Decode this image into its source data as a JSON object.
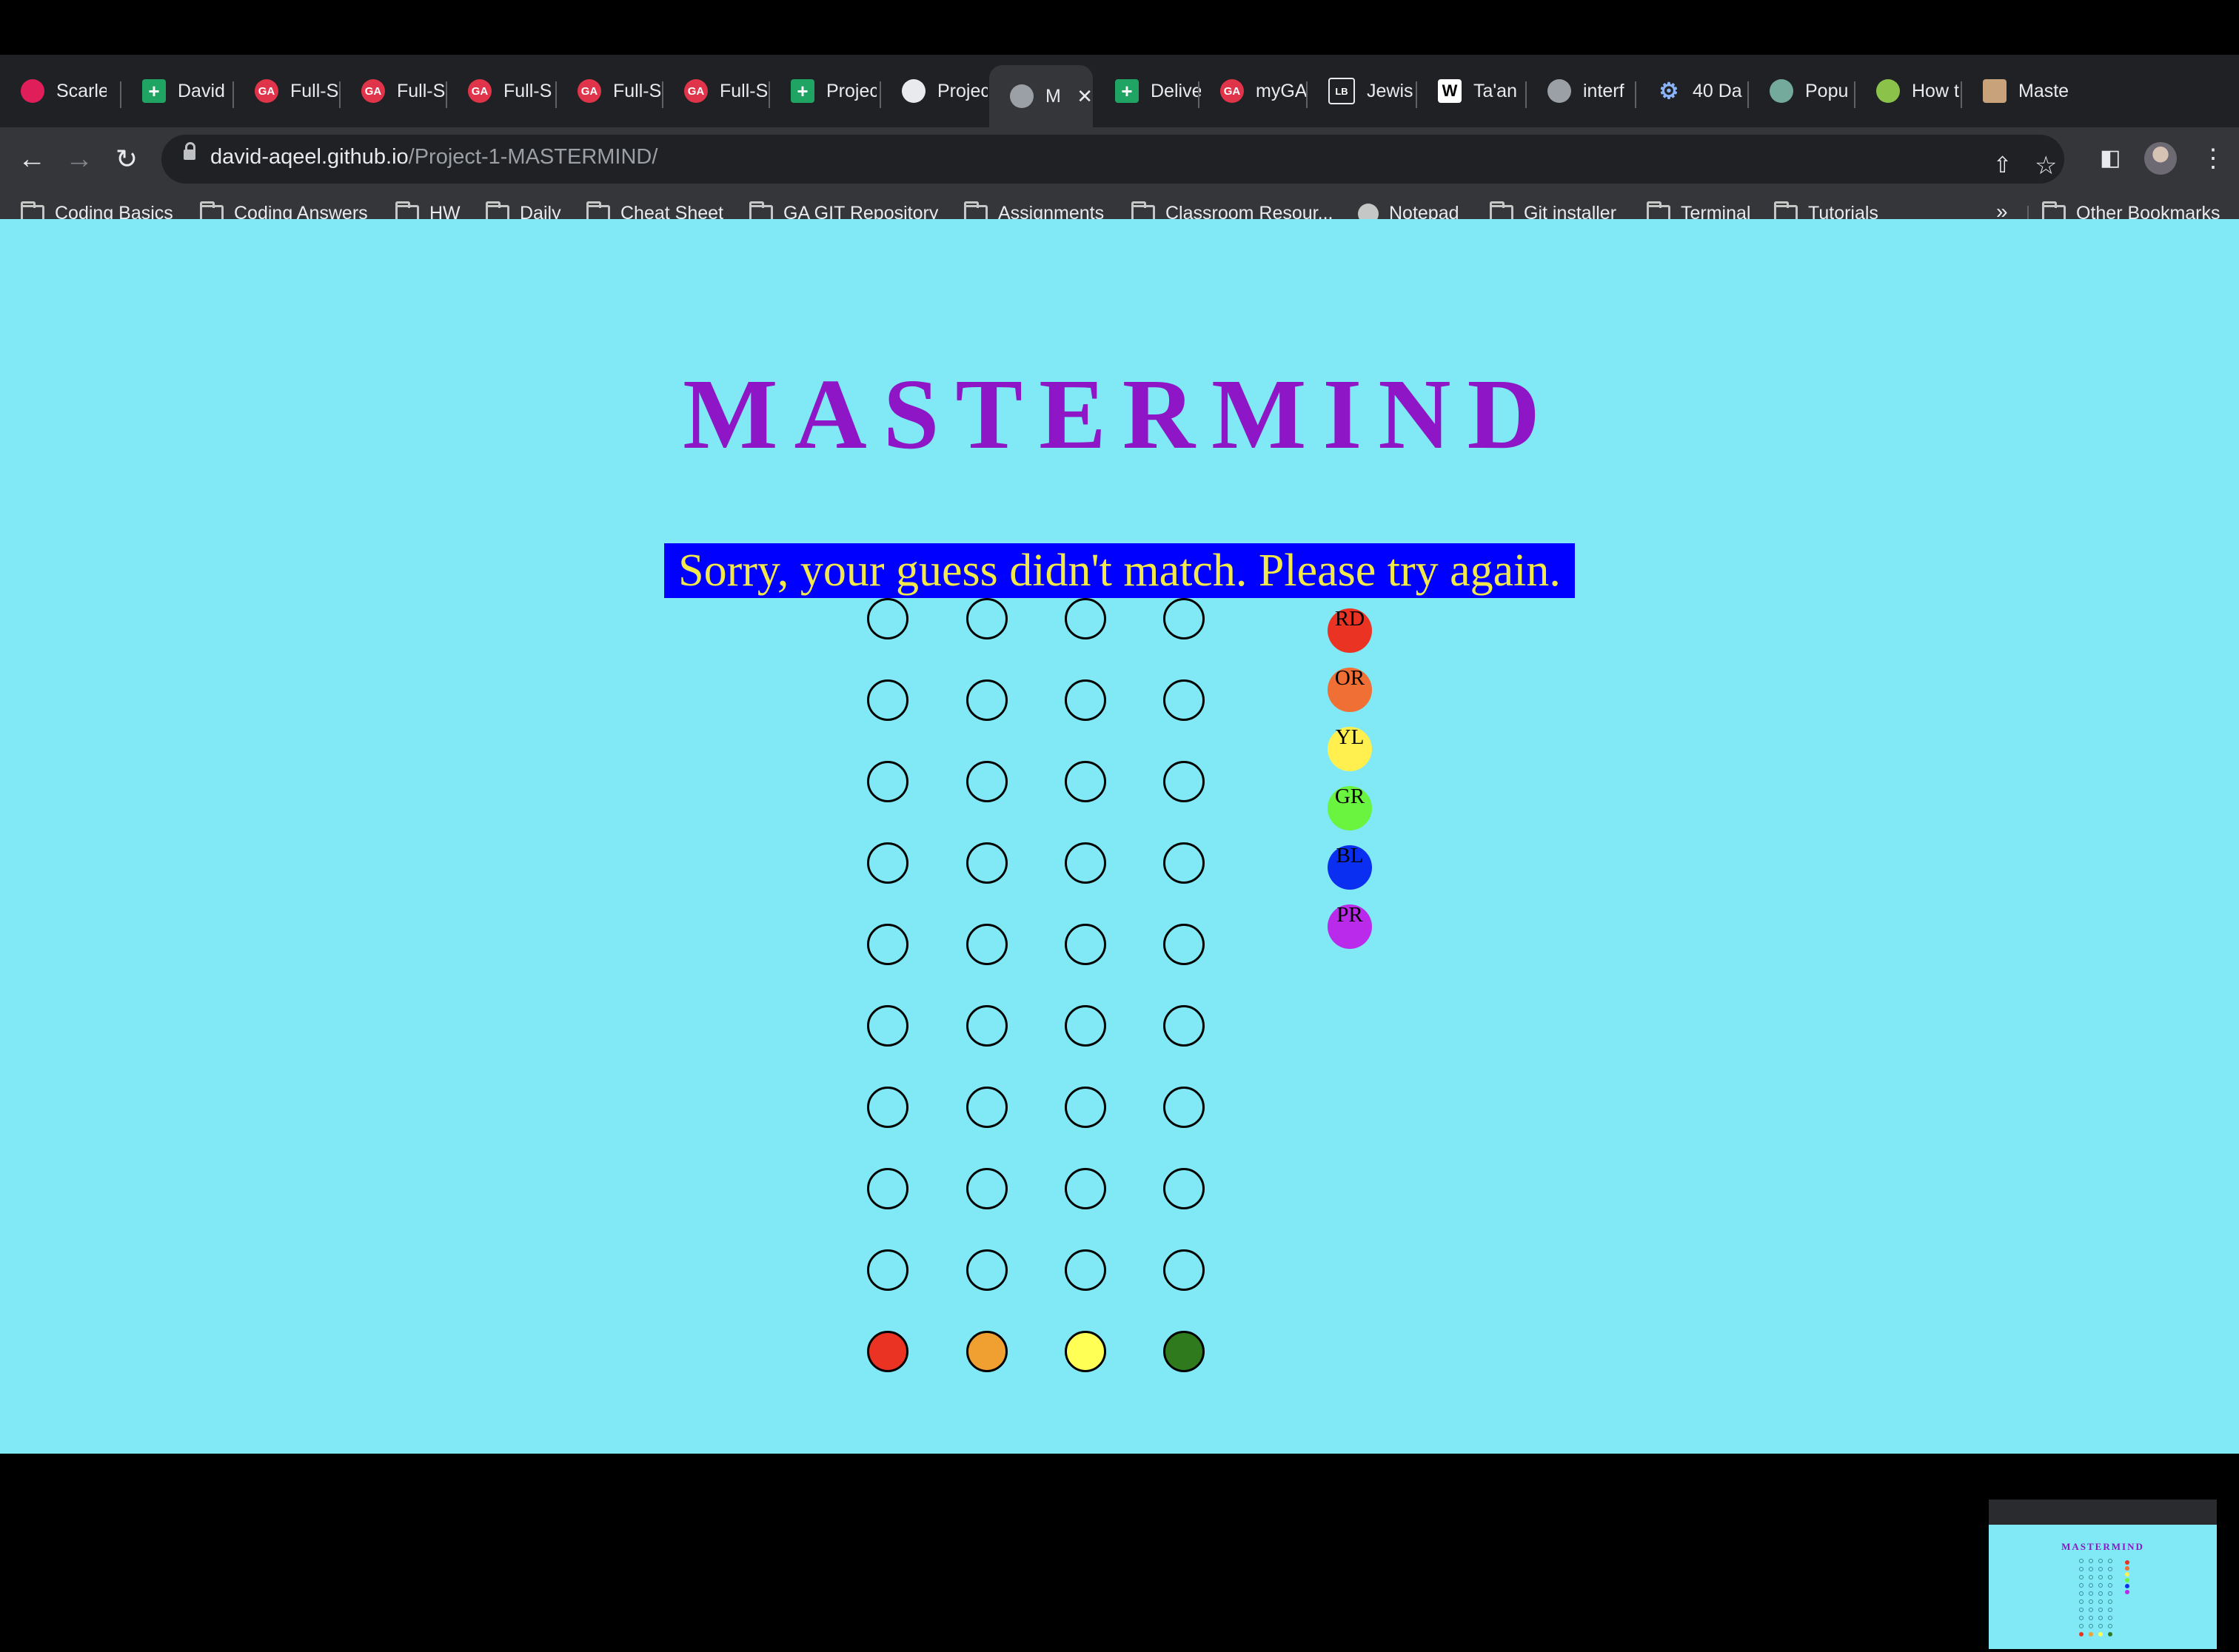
{
  "browser": {
    "tabs": [
      {
        "title": "Scarle",
        "icon": "slack-icon",
        "icon_color": "#e01e5a"
      },
      {
        "title": "David",
        "icon": "sheets-icon",
        "icon_color": "#1fa463"
      },
      {
        "title": "Full-S",
        "icon": "ga-icon",
        "icon_color": "#e0344b"
      },
      {
        "title": "Full-S",
        "icon": "ga-icon",
        "icon_color": "#e0344b"
      },
      {
        "title": "Full-S",
        "icon": "ga-icon",
        "icon_color": "#e0344b"
      },
      {
        "title": "Full-S",
        "icon": "ga-icon",
        "icon_color": "#e0344b"
      },
      {
        "title": "Full-S",
        "icon": "ga-icon",
        "icon_color": "#e0344b"
      },
      {
        "title": "Projec",
        "icon": "sheets-icon",
        "icon_color": "#1fa463"
      },
      {
        "title": "Projec",
        "icon": "github-icon",
        "icon_color": "#ffffff"
      },
      {
        "title": "Ma",
        "icon": "globe-icon",
        "icon_color": "#9aa0a6",
        "active": true
      },
      {
        "title": "Delive",
        "icon": "sheets-icon",
        "icon_color": "#1fa463"
      },
      {
        "title": "myGA",
        "icon": "ga-icon",
        "icon_color": "#e0344b"
      },
      {
        "title": "Jewis",
        "icon": "lb-icon",
        "icon_color": "#202124"
      },
      {
        "title": "Ta'an",
        "icon": "wikipedia-icon",
        "icon_color": "#ffffff"
      },
      {
        "title": "interf",
        "icon": "globe-icon",
        "icon_color": "#9aa0a6"
      },
      {
        "title": "40 Da",
        "icon": "gear-icon",
        "icon_color": "#8ab4f8"
      },
      {
        "title": "Popu",
        "icon": "openai-icon",
        "icon_color": "#74aa9c"
      },
      {
        "title": "How t",
        "icon": "ai-icon",
        "icon_color": "#8bc34a"
      },
      {
        "title": "Maste",
        "icon": "avatar-icon",
        "icon_color": "#c8a27a"
      }
    ],
    "url": {
      "host": "david-aqeel.github.io",
      "path": "/Project-1-MASTERMIND/"
    },
    "bookmarks": [
      {
        "label": "Coding Basics",
        "icon": "folder-icon"
      },
      {
        "label": "Coding Answers",
        "icon": "folder-icon"
      },
      {
        "label": "HW",
        "icon": "folder-icon"
      },
      {
        "label": "Daily",
        "icon": "folder-icon"
      },
      {
        "label": "Cheat Sheet",
        "icon": "folder-icon"
      },
      {
        "label": "GA GIT Repository",
        "icon": "folder-icon"
      },
      {
        "label": "Assignments",
        "icon": "folder-icon"
      },
      {
        "label": "Classroom Resour...",
        "icon": "folder-icon"
      },
      {
        "label": "Notepad",
        "icon": "globe-icon"
      },
      {
        "label": "Git installer",
        "icon": "folder-icon"
      },
      {
        "label": "Terminal",
        "icon": "folder-icon"
      },
      {
        "label": "Tutorials",
        "icon": "folder-icon"
      }
    ],
    "bookmarks_overflow": "»",
    "other_bookmarks": "Other Bookmarks"
  },
  "game": {
    "title": "MASTERMIND",
    "message": "Sorry, your guess didn't match. Please try again.",
    "board": {
      "rows": 10,
      "columns": 4,
      "row_colors": [
        [
          null,
          null,
          null,
          null
        ],
        [
          null,
          null,
          null,
          null
        ],
        [
          null,
          null,
          null,
          null
        ],
        [
          null,
          null,
          null,
          null
        ],
        [
          null,
          null,
          null,
          null
        ],
        [
          null,
          null,
          null,
          null
        ],
        [
          null,
          null,
          null,
          null
        ],
        [
          null,
          null,
          null,
          null
        ],
        [
          null,
          null,
          null,
          null
        ],
        [
          "#ea3323",
          "#f0a030",
          "#ffff55",
          "#2f7a1d"
        ]
      ]
    },
    "palette": [
      {
        "label": "RD",
        "color": "#ea3323"
      },
      {
        "label": "OR",
        "color": "#ef6f34"
      },
      {
        "label": "YL",
        "color": "#fff04f"
      },
      {
        "label": "GR",
        "color": "#6af33f"
      },
      {
        "label": "BL",
        "color": "#0b2ff0"
      },
      {
        "label": "PR",
        "color": "#b92aea"
      }
    ]
  }
}
